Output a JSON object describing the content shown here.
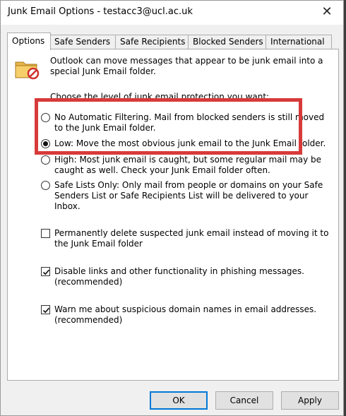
{
  "window": {
    "title": "Junk Email Options - testacc3@ucl.ac.uk",
    "close_glyph": "✕"
  },
  "tabs": [
    {
      "label": "Options",
      "active": true
    },
    {
      "label": "Safe Senders"
    },
    {
      "label": "Safe Recipients"
    },
    {
      "label": "Blocked Senders"
    },
    {
      "label": "International"
    }
  ],
  "intro": {
    "icon": "junk-folder-icon",
    "line1": "Outlook can move messages that appear to be junk email into a",
    "line2": "special Junk Email folder."
  },
  "choose_label": "Choose the level of junk email protection you want:",
  "options": [
    {
      "line1": "No Automatic Filtering. Mail from blocked senders is still moved",
      "line2": "to the Junk Email folder.",
      "checked": false
    },
    {
      "line1": "Low: Move the most obvious junk email to the Junk Email folder.",
      "checked": true
    },
    {
      "line1": "High: Most junk email is caught, but some regular mail may be",
      "line2": "caught as well. Check your Junk Email folder often.",
      "checked": false
    },
    {
      "line1": "Safe Lists Only: Only mail from people or domains on your Safe",
      "line2": "Senders List or Safe Recipients List will be delivered to your",
      "line3": "Inbox.",
      "checked": false
    }
  ],
  "checkboxes": [
    {
      "line1": "Permanently delete suspected junk email instead of moving it to",
      "line2": "the Junk Email folder",
      "checked": false
    },
    {
      "line1": "Disable links and other functionality in phishing messages.",
      "line2": "(recommended)",
      "checked": true
    },
    {
      "line1": "Warn me about suspicious domain names in email addresses.",
      "line2": "(recommended)",
      "checked": true
    }
  ],
  "buttons": {
    "ok": "OK",
    "cancel": "Cancel",
    "apply": "Apply"
  },
  "colors": {
    "highlight": "#d83a3a",
    "accent": "#0078d7"
  }
}
